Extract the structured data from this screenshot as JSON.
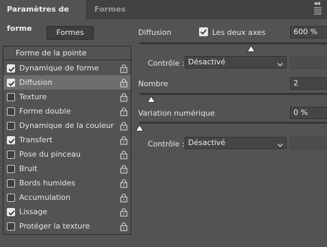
{
  "tabs": [
    {
      "label": "Paramètres de forme",
      "active": true
    },
    {
      "label": "Formes",
      "active": false
    }
  ],
  "presets_button": "Formes",
  "list": {
    "header": "Forme de la pointe",
    "items": [
      {
        "label": "Dynamique de forme",
        "checked": true,
        "selected": false
      },
      {
        "label": "Diffusion",
        "checked": true,
        "selected": true
      },
      {
        "label": "Texture",
        "checked": false,
        "selected": false
      },
      {
        "label": "Forme double",
        "checked": false,
        "selected": false
      },
      {
        "label": "Dynamique de la couleur",
        "checked": false,
        "selected": false
      },
      {
        "label": "Transfert",
        "checked": true,
        "selected": false
      },
      {
        "label": "Pose du pinceau",
        "checked": false,
        "selected": false
      },
      {
        "label": "Bruit",
        "checked": false,
        "selected": false
      },
      {
        "label": "Bords humides",
        "checked": false,
        "selected": false
      },
      {
        "label": "Accumulation",
        "checked": false,
        "selected": false
      },
      {
        "label": "Lissage",
        "checked": true,
        "selected": false
      },
      {
        "label": "Protéger la texture",
        "checked": false,
        "selected": false
      }
    ]
  },
  "scatter": {
    "label": "Diffusion",
    "both_axes_label": "Les deux axes",
    "both_axes_checked": true,
    "value": "600 %",
    "control_label": "Contrôle :",
    "control_value": "Désactivé"
  },
  "count": {
    "label": "Nombre",
    "value": "2"
  },
  "count_jitter": {
    "label": "Variation numérique",
    "value": "0 %",
    "control_label": "Contrôle :",
    "control_value": "Désactivé"
  }
}
